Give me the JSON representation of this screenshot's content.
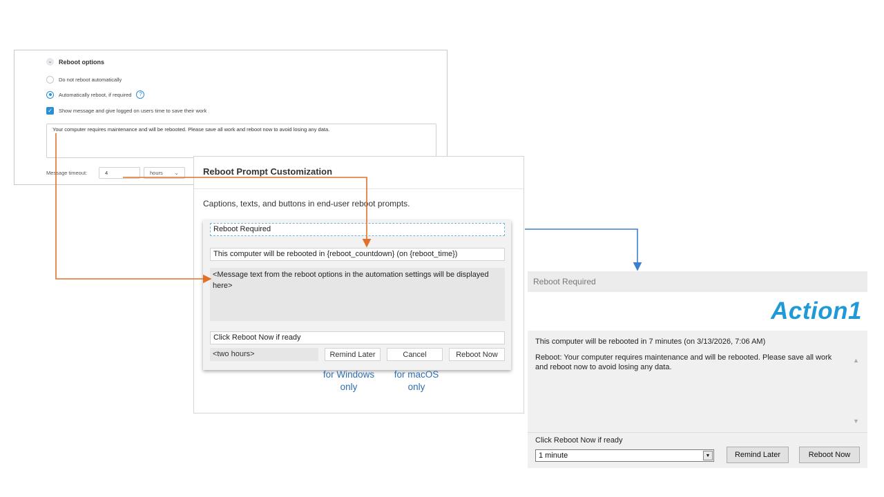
{
  "reboot_options": {
    "section_title": "Reboot options",
    "option_no_reboot": "Do not reboot automatically",
    "option_auto_reboot": "Automatically reboot, if required",
    "help_glyph": "?",
    "option_show_message": "Show message and give logged on users time to save their work",
    "message_text": "Your computer requires maintenance and will be rebooted. Please save all work and reboot now to avoid losing any data.",
    "timeout_label": "Message timeout:",
    "timeout_value": "4",
    "timeout_unit": "hours",
    "selected_option": "auto_reboot",
    "show_message_checked": true
  },
  "customization": {
    "title": "Reboot Prompt Customization",
    "subtitle": "Captions, texts, and buttons in end-user reboot prompts.",
    "caption_field": "Reboot Required",
    "countdown_field": "This computer will be rebooted in {reboot_countdown} (on {reboot_time})",
    "message_placeholder": "<Message text from the reboot options in the automation settings will be displayed here>",
    "click_field": "Click Reboot Now if ready",
    "combo_placeholder": "<two hours>",
    "btn_remind_later": "Remind Later",
    "btn_cancel": "Cancel",
    "btn_reboot_now": "Reboot Now",
    "note_windows": "for Windows only",
    "note_macos": "for macOS only"
  },
  "dialog": {
    "title": "Reboot Required",
    "logo_text": "Action1",
    "countdown": "This computer will be rebooted in 7 minutes (on 3/13/2026, 7:06 AM)",
    "message": "Reboot: Your computer requires maintenance and will be rebooted. Please save all work and reboot now to avoid losing any data.",
    "click_text": "Click Reboot Now if ready",
    "combo_value": "1 minute",
    "btn_remind_later": "Remind Later",
    "btn_reboot_now": "Reboot Now"
  },
  "colors": {
    "accent_blue": "#2a8fd4",
    "connector_orange": "#e0702a",
    "connector_blue": "#3b7fd0",
    "note_blue": "#2f6db0",
    "logo_blue": "#1f9ad6"
  }
}
